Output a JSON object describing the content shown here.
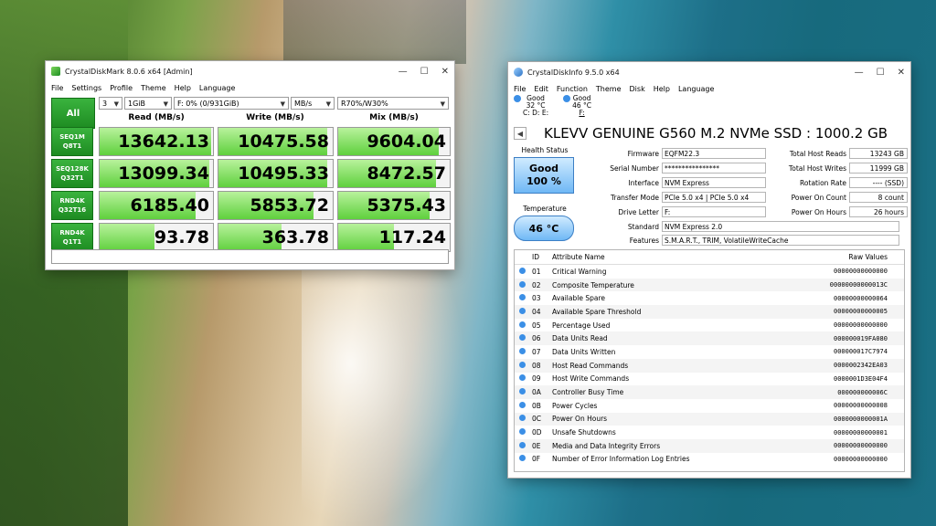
{
  "cdm": {
    "title": "CrystalDiskMark 8.0.6 x64 [Admin]",
    "menu": [
      "File",
      "Settings",
      "Profile",
      "Theme",
      "Help",
      "Language"
    ],
    "all_label": "All",
    "count": "3",
    "size": "1GiB",
    "drive": "F: 0% (0/931GiB)",
    "unit": "MB/s",
    "mix": "R70%/W30%",
    "headers": {
      "read": "Read (MB/s)",
      "write": "Write (MB/s)",
      "mix": "Mix (MB/s)"
    },
    "rows": [
      {
        "l1": "SEQ1M",
        "l2": "Q8T1",
        "read": "13642.13",
        "write": "10475.58",
        "mix": "9604.04",
        "fr": 0.98,
        "fw": 0.95,
        "fm": 0.9
      },
      {
        "l1": "SEQ128K",
        "l2": "Q32T1",
        "read": "13099.34",
        "write": "10495.33",
        "mix": "8472.57",
        "fr": 0.97,
        "fw": 0.95,
        "fm": 0.88
      },
      {
        "l1": "RND4K",
        "l2": "Q32T16",
        "read": "6185.40",
        "write": "5853.72",
        "mix": "5375.43",
        "fr": 0.85,
        "fw": 0.83,
        "fm": 0.82
      },
      {
        "l1": "RND4K",
        "l2": "Q1T1",
        "read": "93.78",
        "write": "363.78",
        "mix": "117.24",
        "fr": 0.48,
        "fw": 0.55,
        "fm": 0.5
      }
    ]
  },
  "cdi": {
    "title": "CrystalDiskInfo 9.5.0 x64",
    "menu": [
      "File",
      "Edit",
      "Function",
      "Theme",
      "Disk",
      "Help",
      "Language"
    ],
    "drives": [
      {
        "status": "Good",
        "temp": "32 °C",
        "letter": "C: D: E:"
      },
      {
        "status": "Good",
        "temp": "46 °C",
        "letter": "F:"
      }
    ],
    "drive_name": "KLEVV GENUINE G560 M.2 NVMe SSD : 1000.2 GB",
    "health_caption": "Health Status",
    "health_status": "Good",
    "health_pct": "100 %",
    "temp_caption": "Temperature",
    "temp_value": "46 °C",
    "fields": {
      "firmware_k": "Firmware",
      "firmware_v": "EQFM22.3",
      "serial_k": "Serial Number",
      "serial_v": "****************",
      "interface_k": "Interface",
      "interface_v": "NVM Express",
      "transfer_k": "Transfer Mode",
      "transfer_v": "PCIe 5.0 x4 | PCIe 5.0 x4",
      "letter_k": "Drive Letter",
      "letter_v": "F:",
      "standard_k": "Standard",
      "standard_v": "NVM Express 2.0",
      "features_k": "Features",
      "features_v": "S.M.A.R.T., TRIM, VolatileWriteCache",
      "reads_k": "Total Host Reads",
      "reads_v": "13243 GB",
      "writes_k": "Total Host Writes",
      "writes_v": "11999 GB",
      "rotation_k": "Rotation Rate",
      "rotation_v": "---- (SSD)",
      "poncount_k": "Power On Count",
      "poncount_v": "8 count",
      "ponhours_k": "Power On Hours",
      "ponhours_v": "26 hours"
    },
    "smart_headers": {
      "id": "ID",
      "name": "Attribute Name",
      "raw": "Raw Values"
    },
    "smart": [
      [
        "01",
        "Critical Warning",
        "00000000000000"
      ],
      [
        "02",
        "Composite Temperature",
        "00000000000013C"
      ],
      [
        "03",
        "Available Spare",
        "00000000000064"
      ],
      [
        "04",
        "Available Spare Threshold",
        "00000000000005"
      ],
      [
        "05",
        "Percentage Used",
        "00000000000000"
      ],
      [
        "06",
        "Data Units Read",
        "000000019FA080"
      ],
      [
        "07",
        "Data Units Written",
        "000000017C7974"
      ],
      [
        "08",
        "Host Read Commands",
        "0000002342EA03"
      ],
      [
        "09",
        "Host Write Commands",
        "0000001D3E04F4"
      ],
      [
        "0A",
        "Controller Busy Time",
        "000000000006C"
      ],
      [
        "0B",
        "Power Cycles",
        "00000000000008"
      ],
      [
        "0C",
        "Power On Hours",
        "0000000000001A"
      ],
      [
        "0D",
        "Unsafe Shutdowns",
        "00000000000001"
      ],
      [
        "0E",
        "Media and Data Integrity Errors",
        "00000000000000"
      ],
      [
        "0F",
        "Number of Error Information Log Entries",
        "00000000000000"
      ]
    ]
  }
}
